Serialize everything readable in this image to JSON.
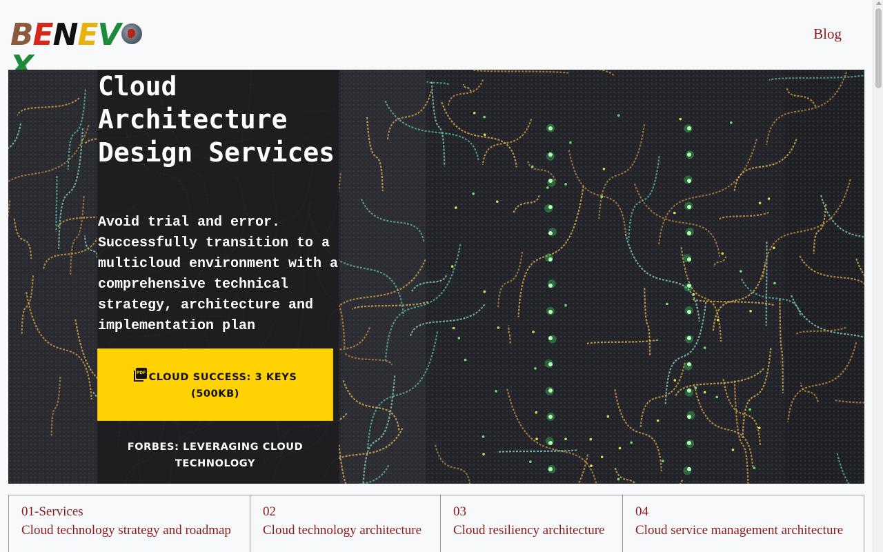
{
  "header": {
    "logo_text": "BENEVOX",
    "logo_letters": [
      "B",
      "E",
      "N",
      "E",
      "V",
      "X"
    ],
    "logo_colors": [
      "#8b5a3c",
      "#d62718",
      "#111111",
      "#e8b20c",
      "#1d8a3a",
      "#1d8a3a"
    ],
    "nav": {
      "blog": "Blog"
    }
  },
  "hero": {
    "title": "Cloud Architecture Design Services",
    "description": "Avoid trial and error. Successfully transition to a multicloud environment with a comprehensive technical strategy, architecture and implementation plan",
    "cta_primary": {
      "label": "CLOUD SUCCESS: 3 KEYS (500KB)",
      "icon": "pdf-icon",
      "icon_text": "PDF",
      "color": "#ffd200"
    },
    "cta_secondary": {
      "label": "FORBES: LEVERAGING CLOUD TECHNOLOGY"
    }
  },
  "services": [
    {
      "num": "01-Services",
      "title": "Cloud technology strategy and roadmap"
    },
    {
      "num": "02",
      "title": "Cloud technology architecture"
    },
    {
      "num": "03",
      "title": "Cloud resiliency architecture"
    },
    {
      "num": "04",
      "title": "Cloud service management architecture"
    }
  ],
  "colors": {
    "accent": "#8b1a1a",
    "cta": "#ffd200",
    "panel": "#1e1e20"
  }
}
